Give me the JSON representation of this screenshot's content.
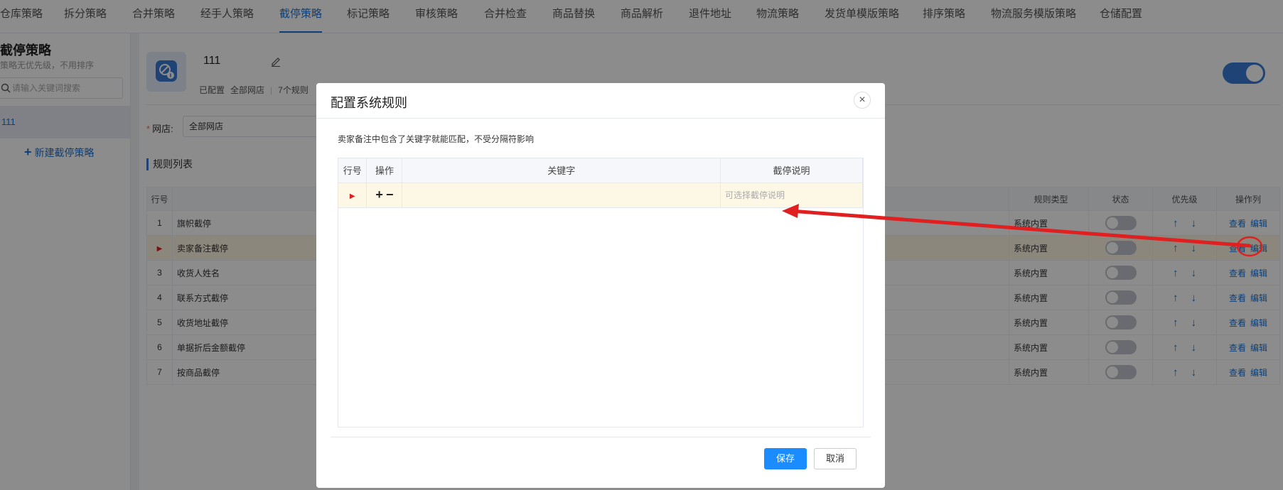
{
  "tabs": [
    {
      "label": "仓库策略",
      "active": false
    },
    {
      "label": "拆分策略",
      "active": false
    },
    {
      "label": "合并策略",
      "active": false
    },
    {
      "label": "经手人策略",
      "active": false
    },
    {
      "label": "截停策略",
      "active": true
    },
    {
      "label": "标记策略",
      "active": false
    },
    {
      "label": "审核策略",
      "active": false
    },
    {
      "label": "合并检查",
      "active": false
    },
    {
      "label": "商品替换",
      "active": false
    },
    {
      "label": "商品解析",
      "active": false
    },
    {
      "label": "退件地址",
      "active": false
    },
    {
      "label": "物流策略",
      "active": false
    },
    {
      "label": "发货单模版策略",
      "active": false
    },
    {
      "label": "排序策略",
      "active": false
    },
    {
      "label": "物流服务模版策略",
      "active": false
    },
    {
      "label": "仓储配置",
      "active": false
    }
  ],
  "sidebar": {
    "title": "截停策略",
    "subtitle": "策略无优先级，不用排序",
    "search_placeholder": "请输入关键词搜索",
    "item": "111",
    "new_label": "新建截停策略"
  },
  "strategy": {
    "name": "111",
    "meta": [
      "已配置",
      "全部网店",
      "7个规则"
    ],
    "shop_label": "网店:",
    "shop_value": "全部网店",
    "section_title": "规则列表",
    "enabled": true
  },
  "rule_table": {
    "headers": {
      "idx": "行号",
      "type": "规则类型",
      "status": "状态",
      "priority": "优先级",
      "ops": "操作列"
    },
    "view_label": "查看",
    "edit_label": "编辑",
    "rows": [
      {
        "idx": "1",
        "name": "旗帜截停",
        "type": "系统内置",
        "selected": false
      },
      {
        "idx": "",
        "name": "卖家备注截停",
        "type": "系统内置",
        "selected": true
      },
      {
        "idx": "3",
        "name": "收货人姓名",
        "type": "系统内置",
        "selected": false
      },
      {
        "idx": "4",
        "name": "联系方式截停",
        "type": "系统内置",
        "selected": false
      },
      {
        "idx": "5",
        "name": "收货地址截停",
        "type": "系统内置",
        "selected": false
      },
      {
        "idx": "6",
        "name": "单据折后金额截停",
        "type": "系统内置",
        "selected": false
      },
      {
        "idx": "7",
        "name": "按商品截停",
        "type": "系统内置",
        "selected": false
      }
    ]
  },
  "modal": {
    "title": "配置系统规则",
    "description": "卖家备注中包含了关键字就能匹配，不受分隔符影响",
    "headers": {
      "idx": "行号",
      "op": "操作",
      "keyword": "关键字",
      "desc": "截停说明"
    },
    "desc_placeholder": "可选择截停说明",
    "save_label": "保存",
    "cancel_label": "取消"
  },
  "colors": {
    "accent": "#1a73d8",
    "annotation": "#e02020",
    "selected_row": "#fdf6e3"
  }
}
